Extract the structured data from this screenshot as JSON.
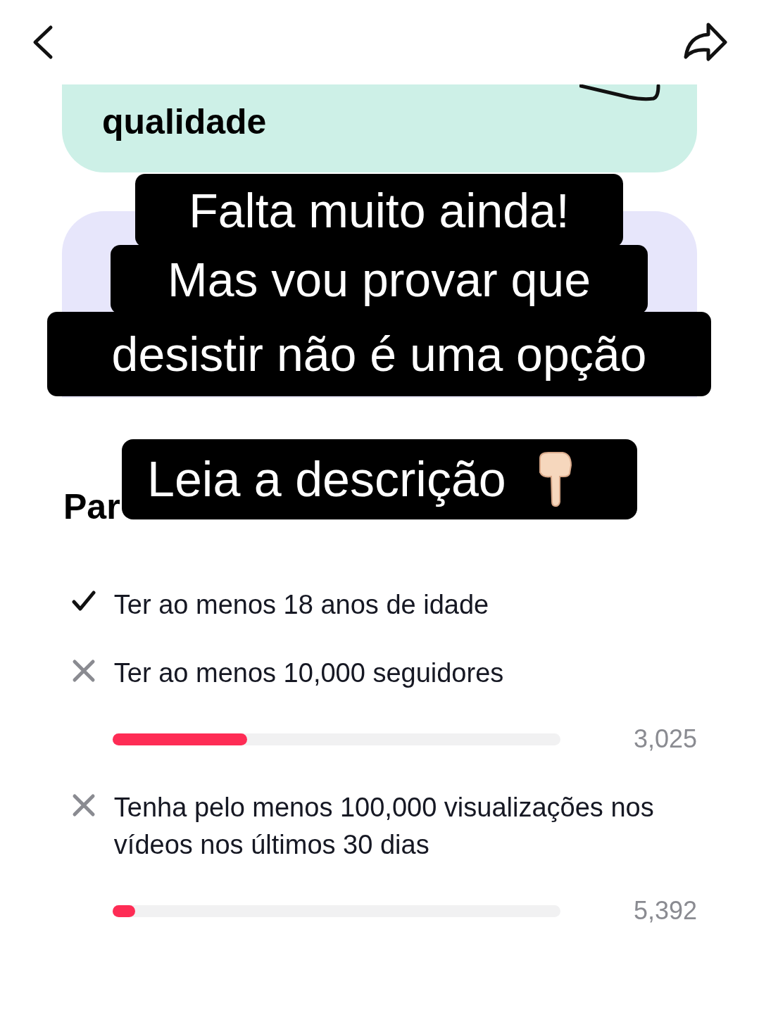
{
  "cards": [
    {
      "kind": "teal",
      "color": "#cdf0e7",
      "text": "qualidade"
    },
    {
      "kind": "purple",
      "color": "#e7e6fb"
    }
  ],
  "captions": [
    "Falta muito ainda!",
    "Mas vou provar que",
    "desistir não é uma opção"
  ],
  "sticker": {
    "text": "Leia a descrição"
  },
  "section": {
    "title": "Par"
  },
  "requirements": [
    {
      "kind": "plain",
      "met": true,
      "text": "Ter ao menos 18 anos de idade"
    },
    {
      "kind": "progress",
      "met": false,
      "text": "Ter ao menos 10,000 seguidores",
      "level": 0.3,
      "reading": "3,025"
    },
    {
      "kind": "progress",
      "met": false,
      "text": "Tenha pelo menos 100,000 visualizações nos vídeos nos últimos 30 dias",
      "level": 0.05,
      "reading": "5,392"
    }
  ]
}
